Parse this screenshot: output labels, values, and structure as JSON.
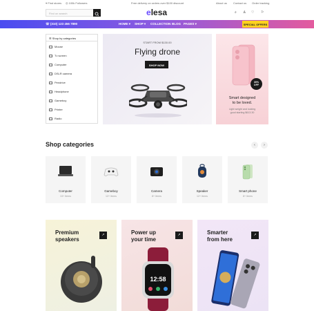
{
  "topbar": {
    "find_stores": "Find stores",
    "followers": "100k Followers",
    "promo": "Free delivery on orders over $100 discount",
    "about": "About us",
    "contact": "Contact us",
    "tracking": "Order tracking"
  },
  "header": {
    "search_placeholder": "Find on search",
    "logo_e": "e",
    "logo_rest": "lesa"
  },
  "nav": {
    "phone": "(310) 123 456 7890",
    "items": [
      "HOME",
      "SHOP",
      "COLLECTION",
      "BLOG",
      "PAGES"
    ],
    "special": "SPECIAL OFFERS"
  },
  "sidebar": {
    "title": "Shop by categories",
    "items": [
      "Mouse",
      "Tv screen",
      "Computer",
      "DSLR camera",
      "Pendrive",
      "Headphone",
      "Gameboy",
      "Printer",
      "Radio"
    ]
  },
  "hero": {
    "subtitle": "START FROM $130.00",
    "title": "Flying drone",
    "button": "SHOP NOW"
  },
  "promo": {
    "badge_value": "30%",
    "badge_label": "OFF",
    "title_line1": "Smart designed",
    "title_line2": "to be loved.",
    "text_line1": "Light weight and looking",
    "text_line2": "good starting $613.30"
  },
  "categories": {
    "title": "Shop categories",
    "prev": "‹",
    "next": "›",
    "cards": [
      {
        "name": "Computer",
        "count": "13+ Items"
      },
      {
        "name": "Gameboy",
        "count": "12+ Items"
      },
      {
        "name": "Camera",
        "count": "8+ Items"
      },
      {
        "name": "Speaker",
        "count": "12+ Items"
      },
      {
        "name": "Smart phone",
        "count": "8+ Items"
      }
    ]
  },
  "bottom_promos": [
    {
      "line1": "Premium",
      "line2": "speakers",
      "arrow": "↗"
    },
    {
      "line1": "Power up",
      "line2": "your time",
      "arrow": "↗"
    },
    {
      "line1": "Smarter",
      "line2": "from here",
      "arrow": "↗"
    }
  ],
  "watch_time": "12:58"
}
